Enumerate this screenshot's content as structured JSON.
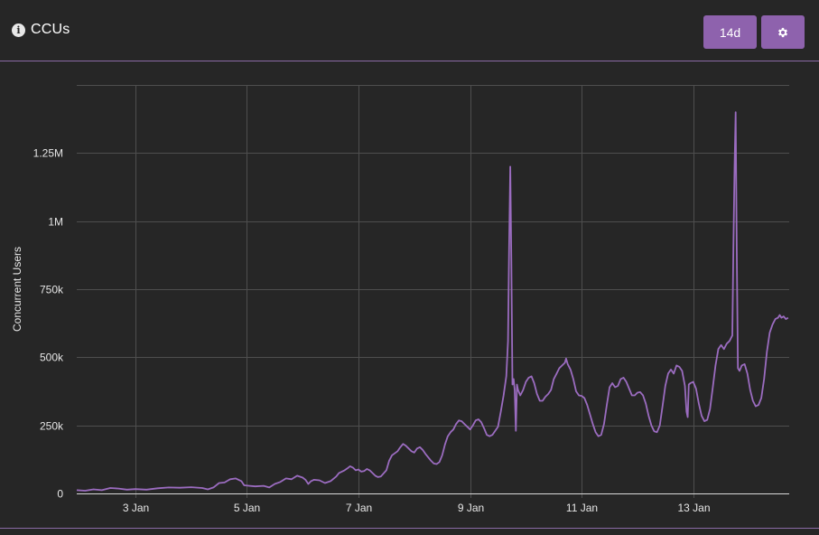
{
  "header": {
    "title": "CCUs",
    "range_label": "14d"
  },
  "icons": {
    "info": "info-icon",
    "settings": "gear-icon"
  },
  "colors": {
    "accent": "#8e62ad",
    "line": "#9b6cc0",
    "background": "#262626"
  },
  "chart_data": {
    "type": "line",
    "title": "",
    "xlabel": "",
    "ylabel": "Concurrent Users",
    "x_range": [
      1.95,
      14.72
    ],
    "ylim": [
      0,
      1500000
    ],
    "x_tick_days": [
      3,
      5,
      7,
      9,
      11,
      13
    ],
    "x_tick_labels": [
      "3 Jan",
      "5 Jan",
      "7 Jan",
      "9 Jan",
      "11 Jan",
      "13 Jan"
    ],
    "y_ticks": [
      0,
      250000,
      500000,
      750000,
      1000000,
      1250000
    ],
    "y_tick_labels": [
      "0",
      "250k",
      "500k",
      "750k",
      "1M",
      "1.25M"
    ],
    "grid": true,
    "legend": "none",
    "series": [
      {
        "x_unit": "day of January",
        "points": [
          [
            1.95,
            12000
          ],
          [
            2.1,
            10000
          ],
          [
            2.25,
            15000
          ],
          [
            2.4,
            12000
          ],
          [
            2.55,
            20000
          ],
          [
            2.7,
            18000
          ],
          [
            2.85,
            14000
          ],
          [
            3.0,
            16000
          ],
          [
            3.2,
            14000
          ],
          [
            3.4,
            19000
          ],
          [
            3.6,
            22000
          ],
          [
            3.8,
            21000
          ],
          [
            4.0,
            23000
          ],
          [
            4.2,
            20000
          ],
          [
            4.3,
            15000
          ],
          [
            4.4,
            22000
          ],
          [
            4.5,
            38000
          ],
          [
            4.6,
            40000
          ],
          [
            4.7,
            52000
          ],
          [
            4.8,
            55000
          ],
          [
            4.9,
            45000
          ],
          [
            4.95,
            30000
          ],
          [
            5.05,
            28000
          ],
          [
            5.15,
            26000
          ],
          [
            5.3,
            28000
          ],
          [
            5.4,
            22000
          ],
          [
            5.5,
            35000
          ],
          [
            5.6,
            42000
          ],
          [
            5.7,
            55000
          ],
          [
            5.8,
            52000
          ],
          [
            5.9,
            65000
          ],
          [
            6.0,
            58000
          ],
          [
            6.05,
            50000
          ],
          [
            6.1,
            35000
          ],
          [
            6.15,
            45000
          ],
          [
            6.2,
            50000
          ],
          [
            6.3,
            48000
          ],
          [
            6.4,
            38000
          ],
          [
            6.5,
            45000
          ],
          [
            6.6,
            62000
          ],
          [
            6.65,
            75000
          ],
          [
            6.7,
            80000
          ],
          [
            6.75,
            85000
          ],
          [
            6.8,
            92000
          ],
          [
            6.85,
            100000
          ],
          [
            6.9,
            95000
          ],
          [
            6.95,
            85000
          ],
          [
            7.0,
            88000
          ],
          [
            7.05,
            80000
          ],
          [
            7.1,
            82000
          ],
          [
            7.15,
            90000
          ],
          [
            7.2,
            85000
          ],
          [
            7.25,
            75000
          ],
          [
            7.3,
            65000
          ],
          [
            7.35,
            60000
          ],
          [
            7.4,
            62000
          ],
          [
            7.5,
            85000
          ],
          [
            7.55,
            120000
          ],
          [
            7.6,
            140000
          ],
          [
            7.7,
            155000
          ],
          [
            7.75,
            170000
          ],
          [
            7.8,
            182000
          ],
          [
            7.85,
            175000
          ],
          [
            7.9,
            165000
          ],
          [
            7.95,
            155000
          ],
          [
            8.0,
            150000
          ],
          [
            8.05,
            165000
          ],
          [
            8.1,
            170000
          ],
          [
            8.15,
            160000
          ],
          [
            8.2,
            145000
          ],
          [
            8.3,
            120000
          ],
          [
            8.35,
            110000
          ],
          [
            8.4,
            108000
          ],
          [
            8.45,
            115000
          ],
          [
            8.5,
            140000
          ],
          [
            8.55,
            180000
          ],
          [
            8.6,
            210000
          ],
          [
            8.65,
            225000
          ],
          [
            8.7,
            235000
          ],
          [
            8.75,
            255000
          ],
          [
            8.8,
            268000
          ],
          [
            8.85,
            265000
          ],
          [
            8.9,
            255000
          ],
          [
            8.95,
            245000
          ],
          [
            9.0,
            235000
          ],
          [
            9.05,
            250000
          ],
          [
            9.1,
            268000
          ],
          [
            9.15,
            272000
          ],
          [
            9.2,
            262000
          ],
          [
            9.25,
            240000
          ],
          [
            9.3,
            215000
          ],
          [
            9.35,
            210000
          ],
          [
            9.4,
            215000
          ],
          [
            9.45,
            230000
          ],
          [
            9.5,
            245000
          ],
          [
            9.55,
            300000
          ],
          [
            9.6,
            360000
          ],
          [
            9.65,
            430000
          ],
          [
            9.68,
            560000
          ],
          [
            9.7,
            900000
          ],
          [
            9.72,
            1200000
          ],
          [
            9.74,
            850000
          ],
          [
            9.76,
            400000
          ],
          [
            9.78,
            420000
          ],
          [
            9.8,
            380000
          ],
          [
            9.82,
            230000
          ],
          [
            9.84,
            400000
          ],
          [
            9.86,
            380000
          ],
          [
            9.9,
            360000
          ],
          [
            9.95,
            380000
          ],
          [
            10.0,
            410000
          ],
          [
            10.05,
            425000
          ],
          [
            10.1,
            430000
          ],
          [
            10.15,
            405000
          ],
          [
            10.2,
            365000
          ],
          [
            10.25,
            340000
          ],
          [
            10.3,
            340000
          ],
          [
            10.35,
            355000
          ],
          [
            10.4,
            365000
          ],
          [
            10.45,
            380000
          ],
          [
            10.5,
            420000
          ],
          [
            10.55,
            440000
          ],
          [
            10.6,
            460000
          ],
          [
            10.65,
            470000
          ],
          [
            10.7,
            480000
          ],
          [
            10.72,
            495000
          ],
          [
            10.75,
            475000
          ],
          [
            10.8,
            455000
          ],
          [
            10.85,
            420000
          ],
          [
            10.9,
            375000
          ],
          [
            10.95,
            360000
          ],
          [
            11.0,
            358000
          ],
          [
            11.05,
            350000
          ],
          [
            11.1,
            325000
          ],
          [
            11.15,
            290000
          ],
          [
            11.2,
            255000
          ],
          [
            11.25,
            225000
          ],
          [
            11.3,
            210000
          ],
          [
            11.35,
            215000
          ],
          [
            11.4,
            255000
          ],
          [
            11.45,
            325000
          ],
          [
            11.5,
            390000
          ],
          [
            11.55,
            405000
          ],
          [
            11.6,
            390000
          ],
          [
            11.65,
            395000
          ],
          [
            11.7,
            420000
          ],
          [
            11.75,
            425000
          ],
          [
            11.8,
            410000
          ],
          [
            11.85,
            385000
          ],
          [
            11.9,
            360000
          ],
          [
            11.95,
            360000
          ],
          [
            12.0,
            370000
          ],
          [
            12.05,
            372000
          ],
          [
            12.1,
            360000
          ],
          [
            12.15,
            330000
          ],
          [
            12.2,
            285000
          ],
          [
            12.25,
            250000
          ],
          [
            12.3,
            228000
          ],
          [
            12.35,
            225000
          ],
          [
            12.4,
            250000
          ],
          [
            12.45,
            320000
          ],
          [
            12.5,
            395000
          ],
          [
            12.55,
            440000
          ],
          [
            12.6,
            455000
          ],
          [
            12.65,
            440000
          ],
          [
            12.7,
            470000
          ],
          [
            12.75,
            465000
          ],
          [
            12.8,
            450000
          ],
          [
            12.85,
            395000
          ],
          [
            12.88,
            300000
          ],
          [
            12.9,
            280000
          ],
          [
            12.92,
            400000
          ],
          [
            12.95,
            405000
          ],
          [
            13.0,
            410000
          ],
          [
            13.05,
            385000
          ],
          [
            13.1,
            330000
          ],
          [
            13.15,
            285000
          ],
          [
            13.2,
            265000
          ],
          [
            13.25,
            270000
          ],
          [
            13.3,
            310000
          ],
          [
            13.35,
            390000
          ],
          [
            13.4,
            470000
          ],
          [
            13.45,
            530000
          ],
          [
            13.5,
            545000
          ],
          [
            13.55,
            530000
          ],
          [
            13.6,
            550000
          ],
          [
            13.65,
            560000
          ],
          [
            13.7,
            580000
          ],
          [
            13.72,
            900000
          ],
          [
            13.74,
            1200000
          ],
          [
            13.76,
            1400000
          ],
          [
            13.78,
            900000
          ],
          [
            13.8,
            460000
          ],
          [
            13.83,
            450000
          ],
          [
            13.87,
            470000
          ],
          [
            13.92,
            475000
          ],
          [
            13.97,
            440000
          ],
          [
            14.02,
            380000
          ],
          [
            14.07,
            340000
          ],
          [
            14.12,
            320000
          ],
          [
            14.17,
            325000
          ],
          [
            14.22,
            350000
          ],
          [
            14.27,
            420000
          ],
          [
            14.32,
            520000
          ],
          [
            14.37,
            590000
          ],
          [
            14.42,
            620000
          ],
          [
            14.47,
            640000
          ],
          [
            14.52,
            645000
          ],
          [
            14.55,
            655000
          ],
          [
            14.58,
            645000
          ],
          [
            14.62,
            650000
          ],
          [
            14.66,
            640000
          ],
          [
            14.7,
            645000
          ]
        ]
      }
    ]
  }
}
